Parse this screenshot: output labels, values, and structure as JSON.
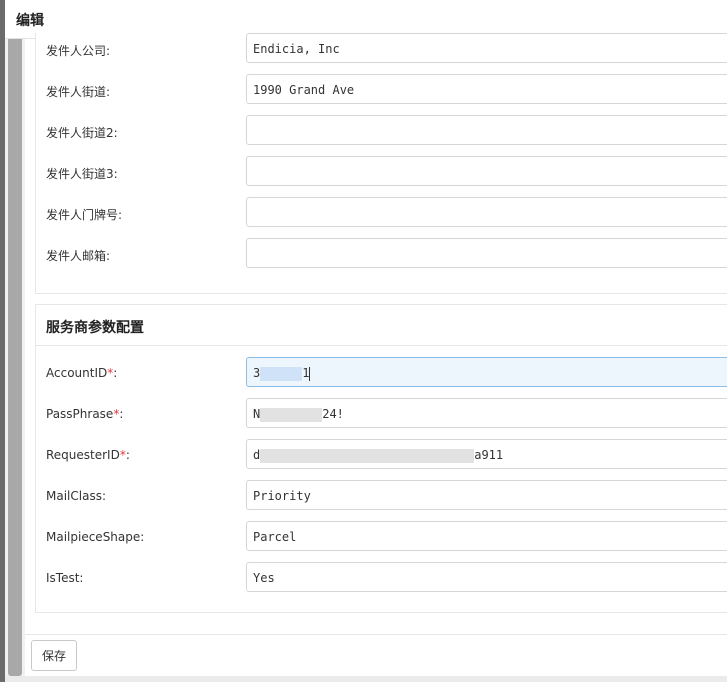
{
  "modal": {
    "title": "编辑"
  },
  "sender_section": {
    "rows": [
      {
        "label": "发件人公司:",
        "value": "Endicia, Inc"
      },
      {
        "label": "发件人街道:",
        "value": "1990 Grand Ave"
      },
      {
        "label": "发件人街道2:",
        "value": ""
      },
      {
        "label": "发件人街道3:",
        "value": ""
      },
      {
        "label": "发件人门牌号:",
        "value": ""
      },
      {
        "label": "发件人邮箱:",
        "value": ""
      }
    ]
  },
  "provider_section": {
    "title": "服务商参数配置",
    "required_marker": "*",
    "account_id": {
      "label": "AccountID",
      "suffix": ":",
      "value_start": "3",
      "value_end": "1"
    },
    "pass_phrase": {
      "label": "PassPhrase",
      "suffix": ":",
      "value_start": "N",
      "value_end": "24!"
    },
    "requester_id": {
      "label": "RequesterID",
      "suffix": ":",
      "value_start": "d",
      "value_end": "a911"
    },
    "mail_class": {
      "label": "MailClass:",
      "value": "Priority"
    },
    "mailpiece_shape": {
      "label": "MailpieceShape:",
      "value": "Parcel"
    },
    "is_test": {
      "label": "IsTest:",
      "value": "Yes"
    }
  },
  "footer": {
    "save_label": "保存"
  },
  "colors": {
    "required": "#e4393c",
    "focus_bg": "#eef6fd",
    "scrollbar_thumb": "#a8a8a8"
  }
}
